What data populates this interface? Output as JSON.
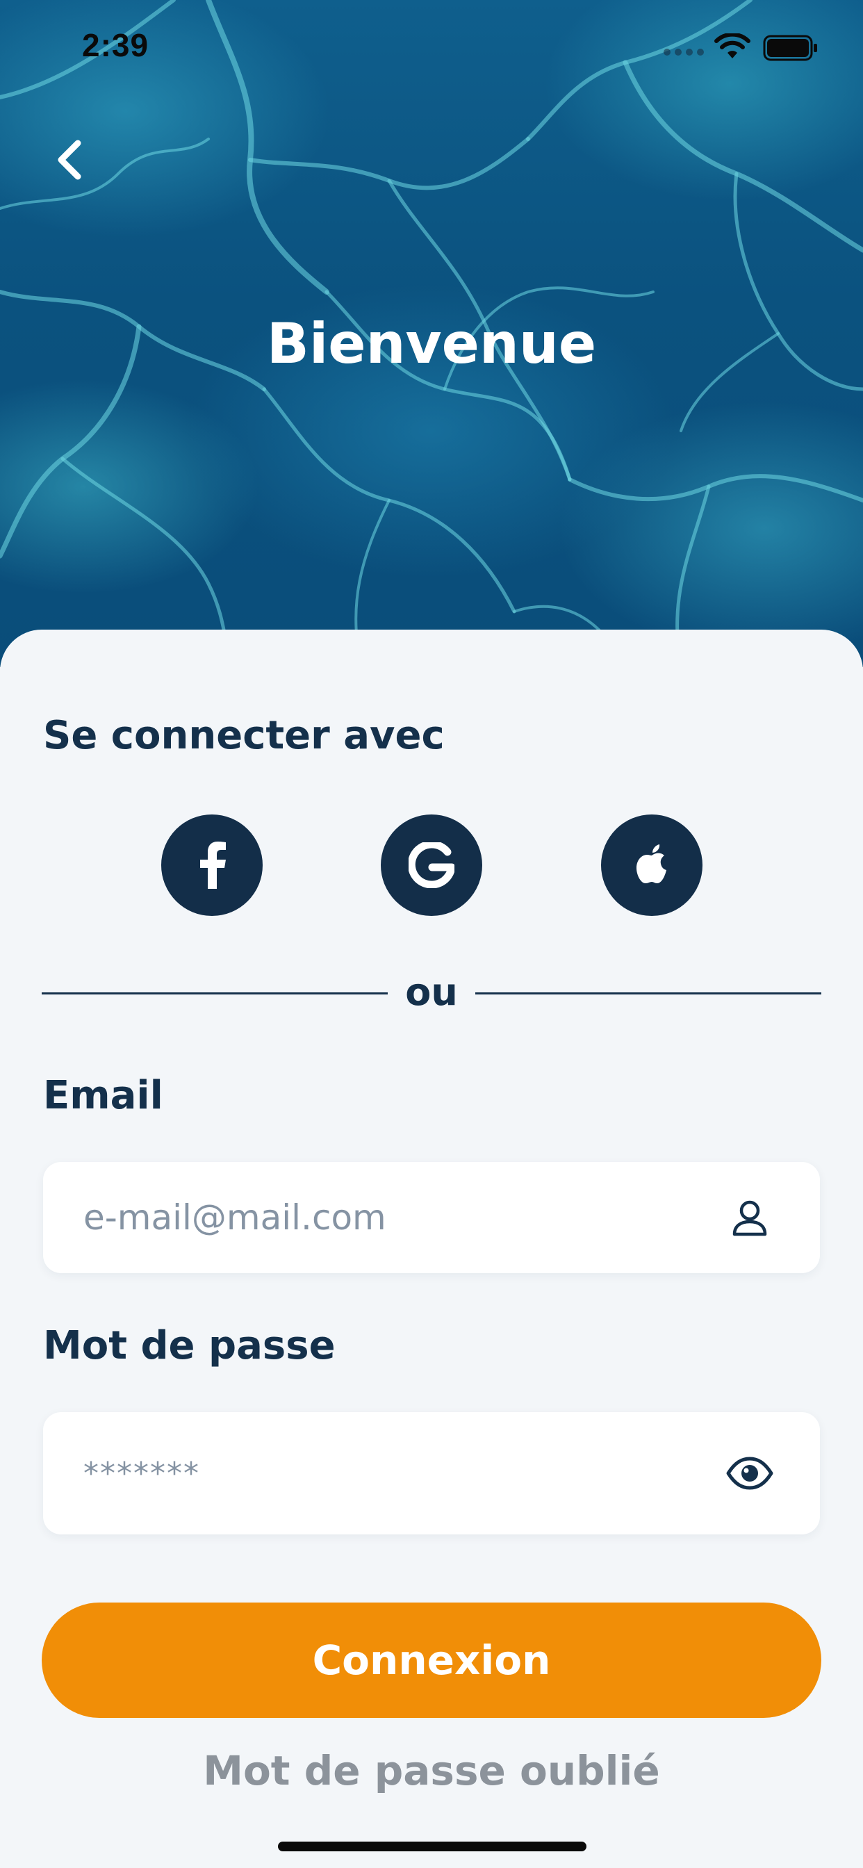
{
  "status_bar": {
    "time": "2:39"
  },
  "header": {
    "back_icon": "chevron-left-icon",
    "title": "Bienvenue"
  },
  "social_login": {
    "title": "Se connecter avec",
    "providers": [
      {
        "name": "facebook",
        "icon": "facebook-icon"
      },
      {
        "name": "google",
        "icon": "google-icon"
      },
      {
        "name": "apple",
        "icon": "apple-icon"
      }
    ],
    "divider_text": "ou"
  },
  "form": {
    "email": {
      "label": "Email",
      "placeholder": "e-mail@mail.com",
      "icon": "user-icon"
    },
    "password": {
      "label": "Mot de passe",
      "placeholder": "*******",
      "icon": "eye-icon"
    },
    "submit_label": "Connexion",
    "forgot_label": "Mot de passe oublié"
  },
  "colors": {
    "primary_dark": "#132e49",
    "accent_orange": "#f18e07",
    "background": "#f3f6f9",
    "muted_text": "#8c939b",
    "hero_blue": "#0b527f"
  }
}
